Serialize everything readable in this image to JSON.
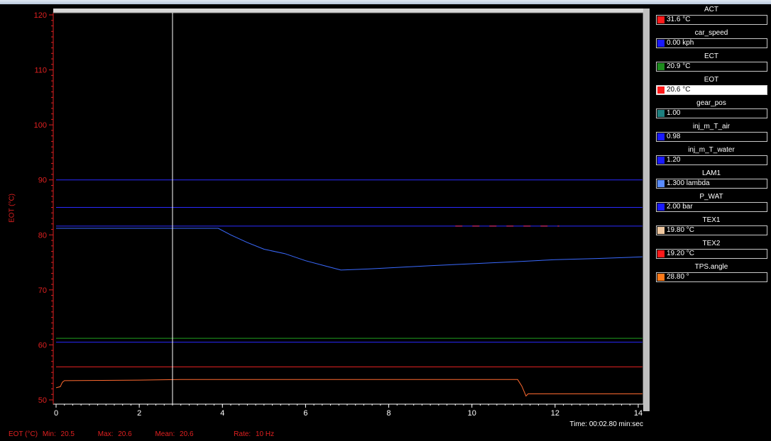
{
  "chart_data": {
    "type": "line",
    "ylabel": "EOT (°C)",
    "xlim": [
      0,
      14.2
    ],
    "ylim": [
      50,
      120
    ],
    "x_ticks": [
      "0",
      "2",
      "4",
      "6",
      "8",
      "10",
      "12",
      "14"
    ],
    "y_ticks": [
      "50",
      "60",
      "70",
      "80",
      "90",
      "100",
      "110",
      "120"
    ],
    "cursor_x": 2.8,
    "grid": false,
    "legend": "right",
    "series": [
      {
        "color": "#2a2aff",
        "points": [
          [
            0,
            90
          ],
          [
            14.1,
            90
          ]
        ]
      },
      {
        "color": "#2a2aff",
        "points": [
          [
            0,
            85
          ],
          [
            14.1,
            85
          ]
        ]
      },
      {
        "color": "#2a2aff",
        "points": [
          [
            0,
            81.6
          ],
          [
            14.1,
            81.6
          ]
        ]
      },
      {
        "color": "#3a6aff",
        "points": [
          [
            0,
            81.2
          ],
          [
            3.9,
            81.2
          ],
          [
            4.2,
            80
          ],
          [
            4.6,
            78.6
          ],
          [
            5.0,
            77.4
          ],
          [
            5.5,
            76.6
          ],
          [
            6.0,
            75.3
          ],
          [
            6.5,
            74.3
          ],
          [
            6.85,
            73.6
          ],
          [
            7.5,
            73.8
          ],
          [
            9,
            74.4
          ],
          [
            11,
            75.1
          ],
          [
            12,
            75.5
          ],
          [
            13,
            75.7
          ],
          [
            14.1,
            76
          ]
        ]
      },
      {
        "color": "#20a020",
        "points": [
          [
            0,
            61.2
          ],
          [
            14.1,
            61.2
          ]
        ]
      },
      {
        "color": "#2a2aff",
        "points": [
          [
            0,
            60.5
          ],
          [
            14.1,
            60.5
          ]
        ]
      },
      {
        "color": "#e02020",
        "points": [
          [
            0,
            56
          ],
          [
            14.1,
            56
          ]
        ]
      },
      {
        "color": "#ff6a30",
        "points": [
          [
            0,
            52.2
          ],
          [
            0.1,
            52.4
          ],
          [
            0.15,
            53.2
          ],
          [
            0.2,
            53.5
          ],
          [
            2,
            53.6
          ],
          [
            3,
            53.7
          ],
          [
            11.1,
            53.7
          ],
          [
            11.2,
            52.5
          ],
          [
            11.3,
            50.7
          ],
          [
            11.35,
            51.1
          ],
          [
            14.1,
            51.1
          ]
        ]
      },
      {
        "color": "#ff3060",
        "dash": "10,14",
        "points": [
          [
            9.6,
            81.6
          ],
          [
            12.1,
            81.6
          ]
        ]
      }
    ]
  },
  "time_readout": "Time: 00:02.80 min:sec",
  "stats": {
    "channel": "EOT (°C)",
    "min_label": "Min:",
    "min_value": "20.5",
    "max_label": "Max:",
    "max_value": "20.6",
    "mean_label": "Mean:",
    "mean_value": "20.6",
    "rate_label": "Rate:",
    "rate_value": "10 Hz"
  },
  "channels": [
    {
      "name": "ACT",
      "value": "31.6 °C",
      "color": "#ff1a1a"
    },
    {
      "name": "car_speed",
      "value": "0.00 kph",
      "color": "#1a1aff"
    },
    {
      "name": "ECT",
      "value": "20.9 °C",
      "color": "#1e8c1e"
    },
    {
      "name": "EOT",
      "value": "20.6 °C",
      "color": "#ff1a1a"
    },
    {
      "name": "gear_pos",
      "value": "1.00",
      "color": "#1e8080"
    },
    {
      "name": "inj_m_T_air",
      "value": "0.98",
      "color": "#1a1aff"
    },
    {
      "name": "inj_m_T_water",
      "value": "1.20",
      "color": "#1a1aff"
    },
    {
      "name": "LAM1",
      "value": "1.300 lambda",
      "color": "#5a8cff"
    },
    {
      "name": "P_WAT",
      "value": "2.00 bar",
      "color": "#1a1aff"
    },
    {
      "name": "TEX1",
      "value": "19.80 °C",
      "color": "#f0c8a0"
    },
    {
      "name": "TEX2",
      "value": "19.20 °C",
      "color": "#ff1a1a"
    },
    {
      "name": "TPS.angle",
      "value": "28.80 °",
      "color": "#ff7a1a"
    }
  ]
}
